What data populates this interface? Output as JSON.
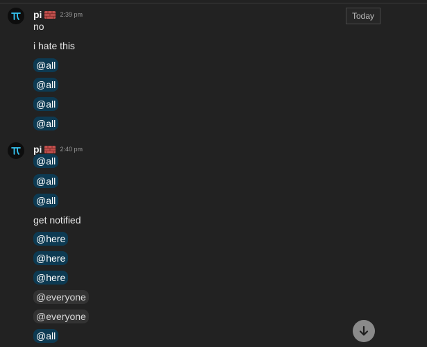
{
  "date_divider": "Today",
  "groups": [
    {
      "username": "pi",
      "time": "2:39 pm",
      "lines": [
        {
          "type": "text",
          "text": "no"
        },
        {
          "type": "text",
          "text": "i hate this"
        },
        {
          "type": "mention",
          "text": "@all"
        },
        {
          "type": "mention",
          "text": "@all"
        },
        {
          "type": "mention",
          "text": "@all"
        },
        {
          "type": "mention",
          "text": "@all"
        }
      ]
    },
    {
      "username": "pi",
      "time": "2:40 pm",
      "lines": [
        {
          "type": "mention",
          "text": "@all"
        },
        {
          "type": "mention",
          "text": "@all"
        },
        {
          "type": "mention",
          "text": "@all"
        },
        {
          "type": "text",
          "text": "get notified"
        },
        {
          "type": "mention",
          "text": "@here"
        },
        {
          "type": "mention",
          "text": "@here"
        },
        {
          "type": "mention",
          "text": "@here"
        },
        {
          "type": "mention-plain",
          "text": "@everyone"
        },
        {
          "type": "mention-plain",
          "text": "@everyone"
        },
        {
          "type": "mention",
          "text": "@all"
        }
      ]
    }
  ],
  "icons": {
    "avatar": "pi-symbol-avatar-icon",
    "badge": "brick-emoji-icon",
    "scroll": "arrow-down-icon"
  },
  "colors": {
    "background": "#222222",
    "mention_bg": "#0d3a52",
    "mention_plain_bg": "#333333",
    "avatar_symbol": "#35c6f4"
  }
}
